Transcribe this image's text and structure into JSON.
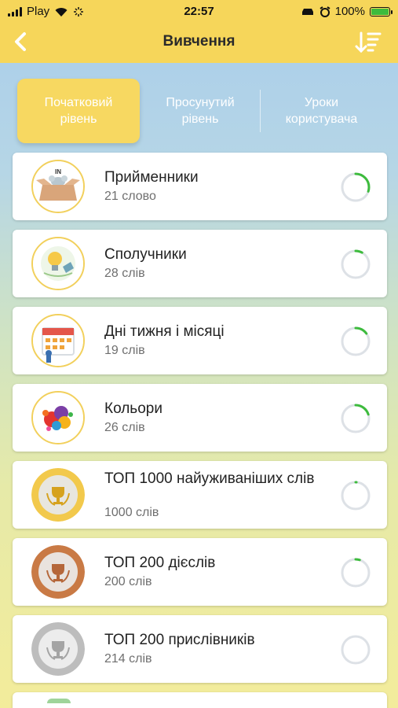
{
  "status": {
    "carrier": "Play",
    "time": "22:57",
    "battery": "100%"
  },
  "header": {
    "title": "Вивчення"
  },
  "tabs": [
    {
      "label": "Початковий рівень",
      "active": true
    },
    {
      "label": "Просунутий рівень",
      "active": false
    },
    {
      "label": "Уроки користувача",
      "active": false
    }
  ],
  "colors": {
    "accent": "#f6d65a",
    "progress": "#3dbb3d",
    "ring": "#dde1e6"
  },
  "lessons": [
    {
      "name": "Прийменники",
      "count": "21 слово",
      "icon": "box-mouse-icon",
      "progress": 0.3
    },
    {
      "name": "Сполучники",
      "count": "28 слів",
      "icon": "lightbulb-icon",
      "progress": 0.08
    },
    {
      "name": "Дні тижня і місяці",
      "count": "19 слів",
      "icon": "calendar-icon",
      "progress": 0.15
    },
    {
      "name": "Кольори",
      "count": "26 слів",
      "icon": "paint-splash-icon",
      "progress": 0.2
    },
    {
      "name": "ТОП 1000 найуживаніших слів",
      "count": "1000 слів",
      "icon": "gold-trophy-icon",
      "progress": 0.01
    },
    {
      "name": "ТОП 200 дієслів",
      "count": "200 слів",
      "icon": "bronze-trophy-icon",
      "progress": 0.05
    },
    {
      "name": "ТОП 200 прислівників",
      "count": "214 слів",
      "icon": "silver-trophy-icon",
      "progress": 0.0
    }
  ]
}
